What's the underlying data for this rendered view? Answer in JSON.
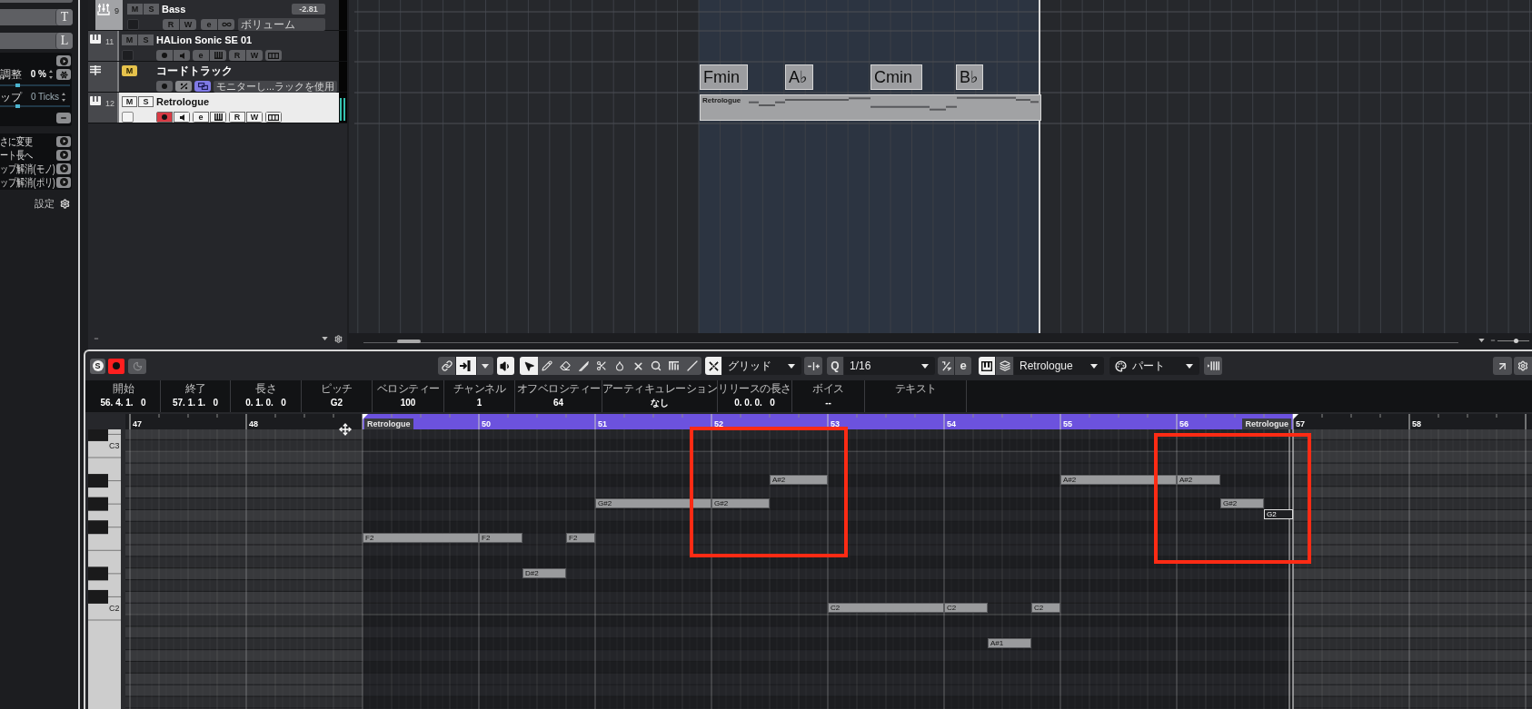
{
  "inspector": {
    "name_fields": [
      {
        "button": "T"
      },
      {
        "button": "L"
      }
    ],
    "value_rows": [
      {
        "label": "調整",
        "value": "0 %",
        "level": 0.25
      },
      {
        "label": "ップ",
        "value": "0 Ticks",
        "level": 0.25
      }
    ],
    "functions": [
      "さに変更",
      "ート長へ",
      "ップ解消(モノ)",
      "ップ解消(ポリ)"
    ],
    "settings": "設定"
  },
  "tracks": [
    {
      "kind": "group",
      "number": "9",
      "name": "Bass",
      "selected": false,
      "mute": {
        "label": "M",
        "on": false
      },
      "solo": {
        "label": "S"
      },
      "value": "-2.81",
      "field": "ボリューム",
      "button_groups": [
        [
          {
            "kind": "read",
            "label": "R"
          },
          {
            "kind": "write",
            "label": "W"
          }
        ],
        [
          {
            "kind": "edit",
            "label": "e"
          },
          {
            "kind": "link"
          }
        ]
      ]
    },
    {
      "kind": "instrument",
      "number": "11",
      "name": "HALion Sonic SE 01",
      "selected": false,
      "mute": {
        "label": "M",
        "on": false
      },
      "solo": {
        "label": "S"
      },
      "button_groups": [
        [
          {
            "kind": "record",
            "on": false
          },
          {
            "kind": "monitor"
          }
        ],
        [
          {
            "kind": "edit",
            "label": "e"
          },
          {
            "kind": "keys"
          }
        ],
        [
          {
            "kind": "read",
            "label": "R"
          },
          {
            "kind": "write",
            "label": "W"
          }
        ],
        [
          {
            "kind": "lanes"
          }
        ]
      ]
    },
    {
      "kind": "chord",
      "name": "コードトラック",
      "selected": false,
      "mute": {
        "label": "M",
        "on": true
      },
      "field": "モニターし...ラックを使用",
      "button_groups": [
        [
          {
            "kind": "record",
            "on": false
          }
        ],
        [
          {
            "kind": "auto_voicing"
          }
        ],
        [
          {
            "kind": "monitor_link",
            "on": true
          }
        ]
      ]
    },
    {
      "kind": "instrument",
      "number": "12",
      "name": "Retrologue",
      "selected": true,
      "level": 0.85,
      "mute": {
        "label": "M",
        "on": false
      },
      "solo": {
        "label": "S"
      },
      "button_groups": [
        [
          {
            "kind": "record",
            "on": true
          },
          {
            "kind": "monitor"
          }
        ],
        [
          {
            "kind": "edit",
            "label": "e"
          },
          {
            "kind": "keys"
          }
        ],
        [
          {
            "kind": "read",
            "label": "R"
          },
          {
            "kind": "write",
            "label": "W"
          }
        ],
        [
          {
            "kind": "lanes"
          }
        ]
      ]
    }
  ],
  "arrangement": {
    "chords": [
      "Fmin",
      "A♭",
      "Cmin",
      "B♭"
    ],
    "part": {
      "name": "Retrologue"
    },
    "zoom": {
      "level": 0.57
    }
  },
  "key_editor": {
    "toolbar": {
      "left_buttons": [
        {
          "kind": "solo",
          "label": "S",
          "on": false
        },
        {
          "kind": "record",
          "on": true
        },
        {
          "kind": "ghost",
          "on": false
        }
      ],
      "scroll_buttons": [
        {
          "kind": "auto_scroll",
          "on": false
        },
        {
          "kind": "follow",
          "on": true
        }
      ],
      "feedback": {
        "on": true
      },
      "tools": [
        {
          "kind": "select",
          "selected": true
        },
        {
          "kind": "draw",
          "selected": false
        },
        {
          "kind": "erase",
          "selected": false
        },
        {
          "kind": "trim",
          "selected": false
        },
        {
          "kind": "split",
          "selected": false
        },
        {
          "kind": "glue",
          "selected": false
        },
        {
          "kind": "mute",
          "selected": false
        },
        {
          "kind": "zoom",
          "selected": false
        },
        {
          "kind": "comp",
          "selected": false
        },
        {
          "kind": "line",
          "selected": false
        }
      ],
      "snap": {
        "on": true,
        "type": "グリッド"
      },
      "quantize": {
        "label": "Q",
        "value": "1/16"
      },
      "quantize_buttons": [
        {
          "kind": "triplet"
        },
        {
          "kind": "legato",
          "label": "e"
        }
      ],
      "instrument_buttons": [
        {
          "kind": "keys",
          "on": true
        },
        {
          "kind": "layers",
          "on": false
        }
      ],
      "instrument": "Retrologue",
      "color_scheme": "パート"
    },
    "info": [
      {
        "label": "開始",
        "value": "56. 4. 1.   0"
      },
      {
        "label": "終了",
        "value": "57. 1. 1.   0"
      },
      {
        "label": "長さ",
        "value": "0. 1. 0.   0"
      },
      {
        "label": "ピッチ",
        "value": "G2"
      },
      {
        "label": "ベロシティー",
        "value": "100"
      },
      {
        "label": "チャンネル",
        "value": "1"
      },
      {
        "label": "オフベロシティー",
        "value": "64"
      },
      {
        "label": "アーティキュレーション",
        "value": "なし"
      },
      {
        "label": "リリースの長さ",
        "value": "0. 0. 0.   0"
      },
      {
        "label": "ボイス",
        "value": "--"
      },
      {
        "label": "テキスト"
      }
    ],
    "ruler": {
      "bars": [
        "47",
        "48",
        "50",
        "51",
        "52",
        "53",
        "54",
        "55",
        "56",
        "57",
        "58"
      ],
      "part_tags": [
        "Retrologue",
        "Retrologue"
      ]
    },
    "key_labels": [
      "C3",
      "C2"
    ],
    "notes": [
      {
        "label": "F2",
        "selected": false
      },
      {
        "label": "F2",
        "selected": false
      },
      {
        "label": "D#2",
        "selected": false
      },
      {
        "label": "F2",
        "selected": false
      },
      {
        "label": "G#2",
        "selected": false
      },
      {
        "label": "G#2",
        "selected": false
      },
      {
        "label": "A#2",
        "selected": false
      },
      {
        "label": "C2",
        "selected": false
      },
      {
        "label": "C2",
        "selected": false
      },
      {
        "label": "A#1",
        "selected": false
      },
      {
        "label": "C2",
        "selected": false
      },
      {
        "label": "A#2",
        "selected": false
      },
      {
        "label": "A#2",
        "selected": false
      },
      {
        "label": "G#2",
        "selected": false
      },
      {
        "label": "G2",
        "selected": true
      }
    ]
  }
}
